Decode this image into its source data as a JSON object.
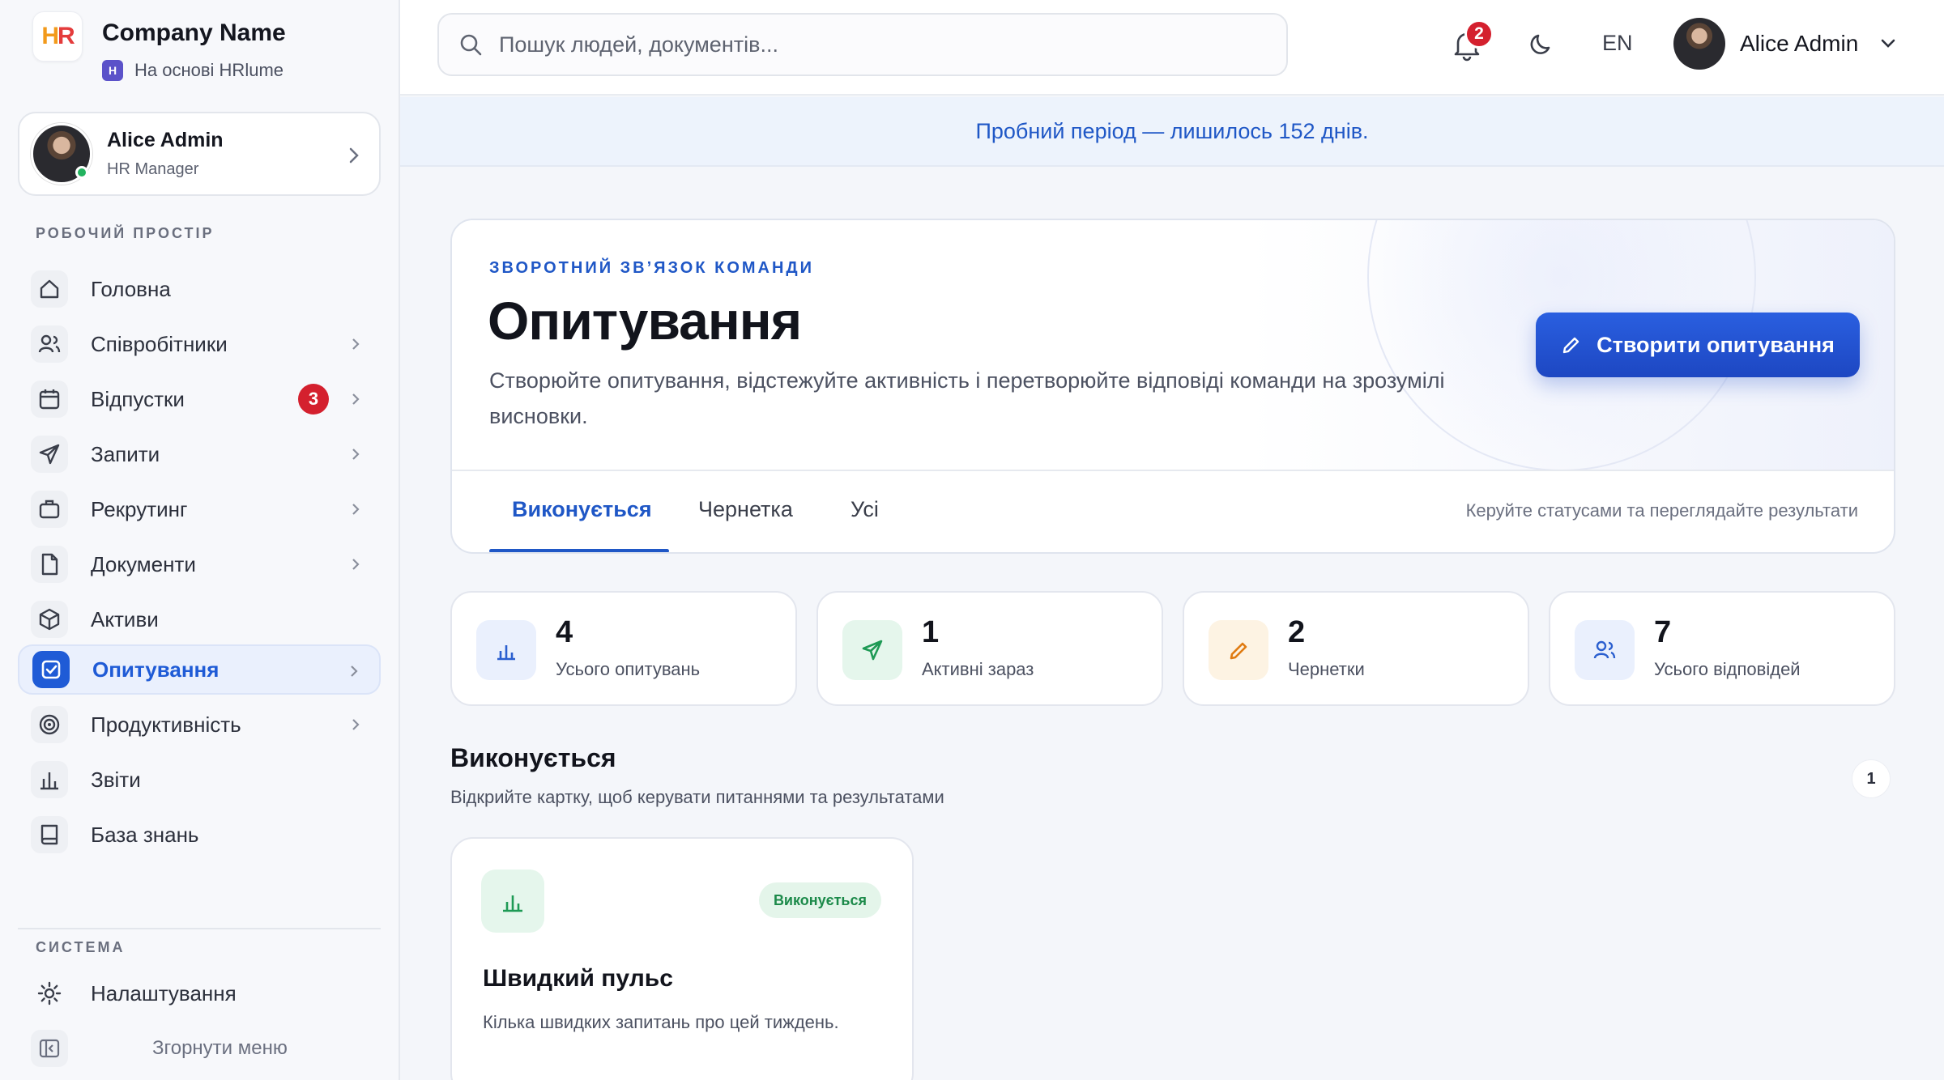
{
  "brand": {
    "logo_text": "HR",
    "company_name": "Company Name",
    "powered_by": "На основі HRlume"
  },
  "sidebar": {
    "user": {
      "name": "Alice Admin",
      "role": "HR Manager"
    },
    "workspace_label": "РОБОЧИЙ ПРОСТІР",
    "items": [
      {
        "label": "Головна",
        "icon": "home-icon"
      },
      {
        "label": "Співробітники",
        "icon": "users-icon"
      },
      {
        "label": "Відпустки",
        "icon": "calendar-icon",
        "badge": "3"
      },
      {
        "label": "Запити",
        "icon": "send-icon"
      },
      {
        "label": "Рекрутинг",
        "icon": "briefcase-icon"
      },
      {
        "label": "Документи",
        "icon": "document-icon"
      },
      {
        "label": "Активи",
        "icon": "box-icon"
      },
      {
        "label": "Опитування",
        "icon": "checkbox-icon",
        "active": true
      },
      {
        "label": "Продуктивність",
        "icon": "target-icon"
      },
      {
        "label": "Звіти",
        "icon": "bar-chart-icon"
      },
      {
        "label": "База знань",
        "icon": "book-icon"
      }
    ],
    "system_label": "СИСТЕМА",
    "settings_label": "Налаштування",
    "collapse_label": "Згорнути меню"
  },
  "topbar": {
    "search_placeholder": "Пошук людей, документів...",
    "notifications_count": "2",
    "language": "EN",
    "user_name": "Alice Admin"
  },
  "trial_banner": "Пробний період — лишилось 152 днів.",
  "hero": {
    "eyebrow": "ЗВОРОТНИЙ ЗВ’ЯЗОК КОМАНДИ",
    "title": "Опитування",
    "description": "Створюйте опитування, відстежуйте активність і перетворюйте відповіді команди на зрозумілі висновки.",
    "create_button": "Створити опитування",
    "tabs": [
      "Виконується",
      "Чернетка",
      "Усі"
    ],
    "tabs_hint": "Керуйте статусами та переглядайте результати"
  },
  "stats": [
    {
      "value": "4",
      "label": "Усього опитувань",
      "icon": "bar-chart-icon",
      "color": "#2b5fcf"
    },
    {
      "value": "1",
      "label": "Активні зараз",
      "icon": "send-icon",
      "color": "#1e9a55"
    },
    {
      "value": "2",
      "label": "Чернетки",
      "icon": "pencil-icon",
      "color": "#e07b12"
    },
    {
      "value": "7",
      "label": "Усього відповідей",
      "icon": "users-icon",
      "color": "#2b5fcf"
    }
  ],
  "section": {
    "title": "Виконується",
    "subtitle": "Відкрийте картку, щоб керувати питаннями та результатами",
    "count": "1"
  },
  "surveys": [
    {
      "title": "Швидкий пульс",
      "description": "Кілька швидких запитань про цей тиждень.",
      "status": "Виконується"
    }
  ],
  "colors": {
    "accent": "#1f57c6",
    "danger": "#d4202e",
    "success": "#1c8a4a"
  }
}
